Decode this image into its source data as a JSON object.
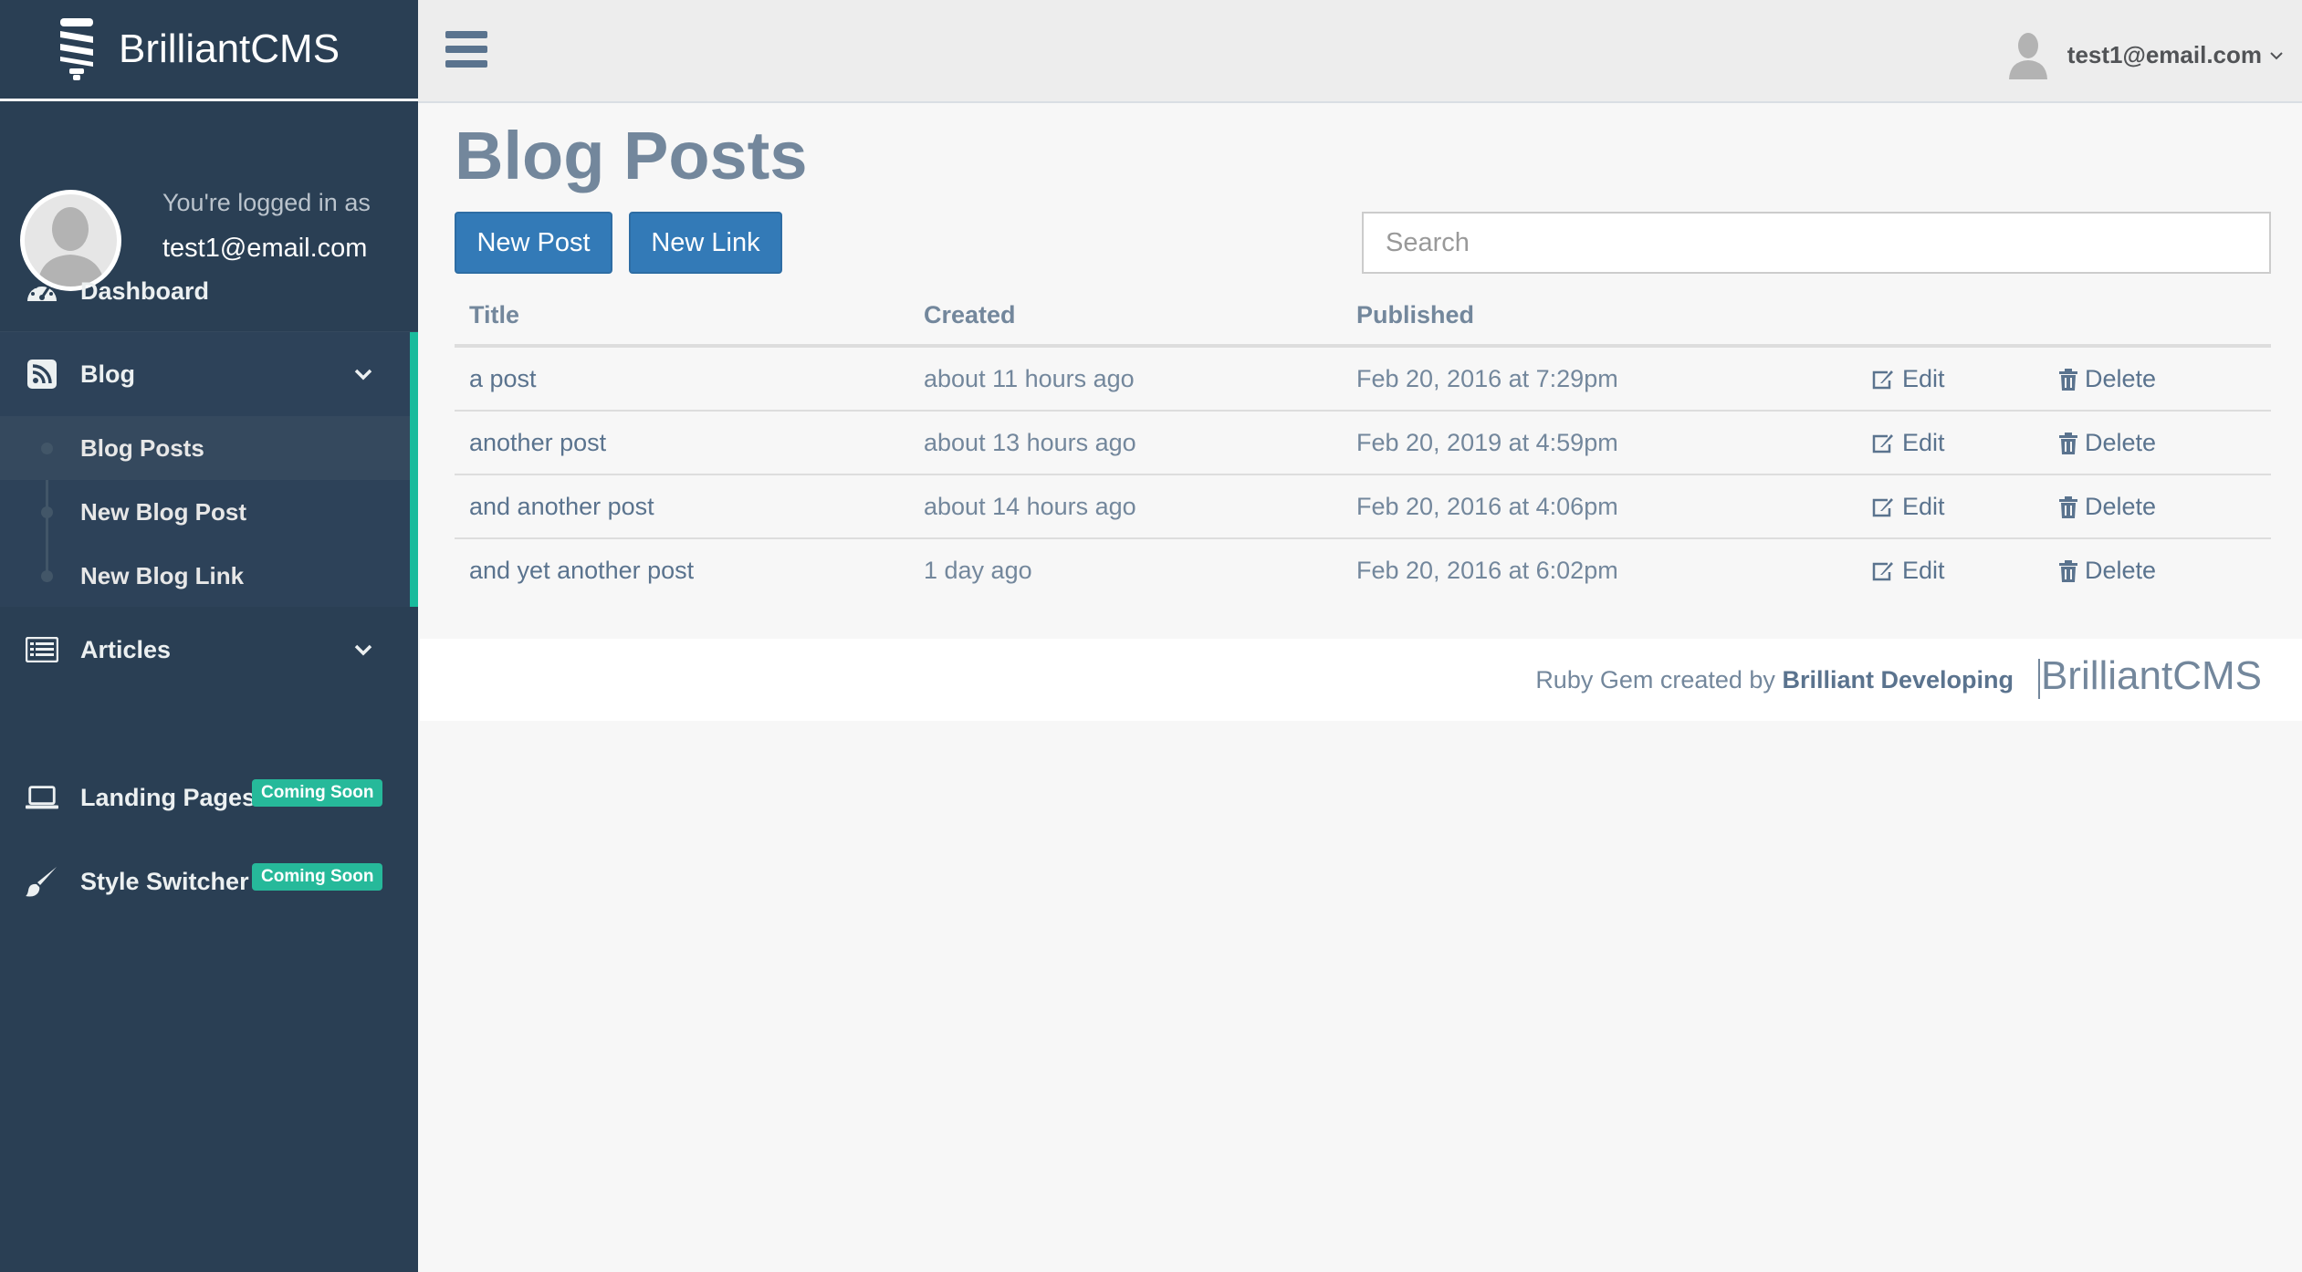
{
  "brand": {
    "name": "BrilliantCMS"
  },
  "profile": {
    "logged_in_label": "You're logged in as",
    "email": "test1@email.com"
  },
  "sidebar": {
    "dashboard": "Dashboard",
    "blog": "Blog",
    "blog_items": [
      "Blog Posts",
      "New Blog Post",
      "New Blog Link"
    ],
    "articles": "Articles",
    "landing_pages": "Landing Pages",
    "style_switcher": "Style Switcher",
    "coming_soon": "Coming Soon"
  },
  "topbar": {
    "user_email": "test1@email.com"
  },
  "main": {
    "title": "Blog Posts",
    "new_post": "New Post",
    "new_link": "New Link",
    "search_placeholder": "Search",
    "columns": [
      "Title",
      "Created",
      "Published"
    ],
    "rows": [
      {
        "title": "a post",
        "created": "about 11 hours ago",
        "published": "Feb 20, 2016 at 7:29pm"
      },
      {
        "title": "another post",
        "created": "about 13 hours ago",
        "published": "Feb 20, 2019 at 4:59pm"
      },
      {
        "title": "and another post",
        "created": "about 14 hours ago",
        "published": "Feb 20, 2016 at 4:06pm"
      },
      {
        "title": "and yet another post",
        "created": "1 day ago",
        "published": "Feb 20, 2016 at 6:02pm"
      }
    ],
    "edit_label": "Edit",
    "delete_label": "Delete"
  },
  "footer": {
    "credit_prefix": "Ruby Gem created by",
    "credit_author": "Brilliant Developing",
    "logo_text": "BrilliantCMS"
  },
  "colors": {
    "sidebar_bg": "#2a3f54",
    "accent_green": "#1abb9c",
    "button_blue": "#337ab7",
    "text_muted": "#73879c"
  }
}
